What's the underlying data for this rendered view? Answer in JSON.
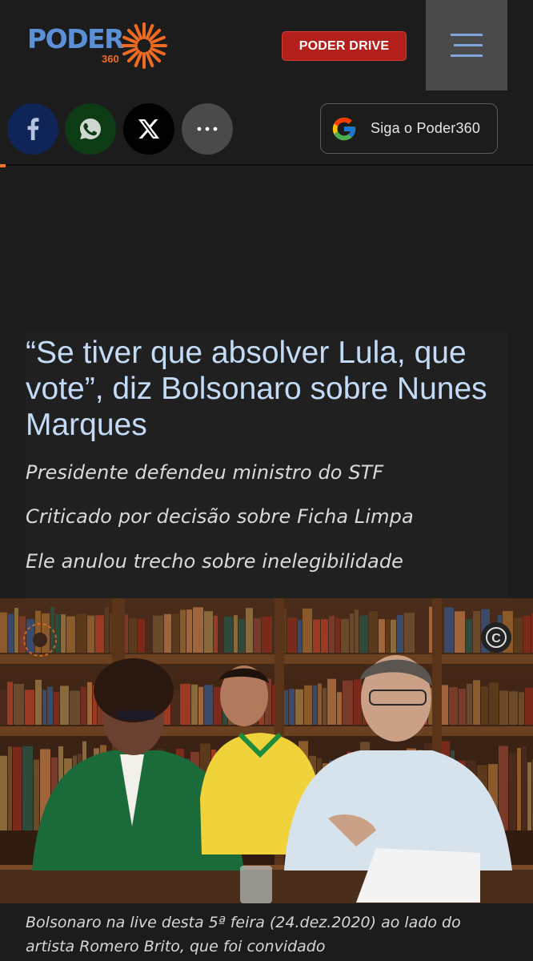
{
  "header": {
    "logo_text": "PODER",
    "logo_sub": "360",
    "drive_button": "PODER DRIVE",
    "menu_icon": "hamburger-icon"
  },
  "share": {
    "facebook_icon": "facebook-icon",
    "whatsapp_icon": "whatsapp-icon",
    "x_icon": "x-icon",
    "more_icon": "more-icon",
    "google_follow": "Siga o Poder360"
  },
  "article": {
    "headline": "“Se tiver que absolver Lula, que vote”, diz Bolsonaro sobre Nunes Marques",
    "bullets": [
      "Presidente defendeu ministro do STF",
      "Criticado por decisão sobre Ficha Limpa",
      "Ele anulou trecho sobre inelegibilidade"
    ],
    "caption": "Bolsonaro na live desta 5ª feira (24.dez.2020) ao lado do artista Romero Brito, que foi convidado"
  },
  "colors": {
    "background": "#1c1c1c",
    "brand_blue": "#5b8fd6",
    "brand_orange": "#ef6b22",
    "drive_red": "#b3201c",
    "headline": "#c3dbf7"
  }
}
